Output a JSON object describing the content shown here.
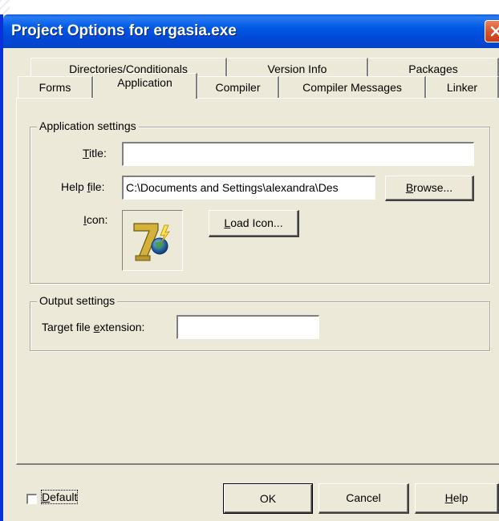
{
  "window": {
    "title": "Project Options for ergasia.exe"
  },
  "tabs": {
    "back_row": [
      "Directories/Conditionals",
      "Version Info",
      "Packages"
    ],
    "front_row": [
      "Forms",
      "Application",
      "Compiler",
      "Compiler Messages",
      "Linker"
    ],
    "active": "Application"
  },
  "application_settings": {
    "group_title": "Application settings",
    "title_label_pre": "",
    "title_label_accel": "T",
    "title_label_post": "itle:",
    "title_value": "",
    "help_label_pre": "Help ",
    "help_label_accel": "f",
    "help_label_post": "ile:",
    "help_value": "C:\\Documents and Settings\\alexandra\\Des",
    "browse_pre": "",
    "browse_accel": "B",
    "browse_post": "rowse...",
    "icon_label_pre": "",
    "icon_label_accel": "I",
    "icon_label_post": "con:",
    "load_icon_pre": "",
    "load_icon_accel": "L",
    "load_icon_post": "oad Icon...",
    "app_icon": "delphi7-icon"
  },
  "output_settings": {
    "group_title": "Output settings",
    "ext_label_pre": "Target file ",
    "ext_label_accel": "e",
    "ext_label_post": "xtension:",
    "ext_value": ""
  },
  "footer": {
    "default_label_pre": "",
    "default_label_accel": "D",
    "default_label_post": "efault",
    "default_checked": false,
    "ok_label": "OK",
    "cancel_label": "Cancel",
    "help_pre": "",
    "help_accel": "H",
    "help_post": "elp"
  },
  "colors": {
    "titlebar": "#0054e3",
    "close": "#d9552d",
    "face": "#ece9d8"
  }
}
